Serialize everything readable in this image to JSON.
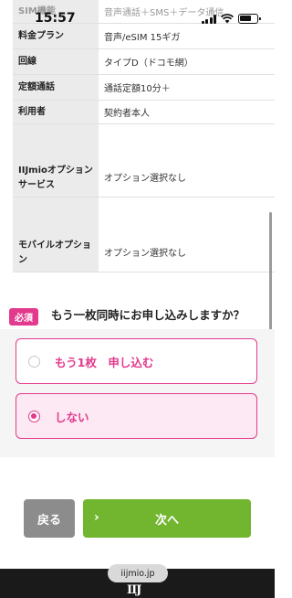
{
  "status_bar": {
    "time": "15:57",
    "icons": [
      "signal-icon",
      "wifi-icon",
      "battery-icon"
    ]
  },
  "table": {
    "rows": [
      {
        "label": "SIM機能",
        "value": "音声通話＋SMS＋データ通信"
      },
      {
        "label": "料金プラン",
        "value": "音声/eSIM 15ギガ"
      },
      {
        "label": "回線",
        "value": "タイプD（ドコモ網）"
      },
      {
        "label": "定額通話",
        "value": "通話定額10分＋"
      },
      {
        "label": "利用者",
        "value": "契約者本人"
      },
      {
        "label": "IIJmioオプションサービス",
        "value": "オプション選択なし"
      },
      {
        "label": "モバイルオプション",
        "value": "オプション選択なし"
      }
    ]
  },
  "question": {
    "badge": "必須",
    "text": "もう一枚同時にお申し込みしますか？"
  },
  "options": [
    {
      "label": "もう1枚　申し込む",
      "selected": false
    },
    {
      "label": "しない",
      "selected": true
    }
  ],
  "buttons": {
    "back": "戻る",
    "next": "次へ"
  },
  "browser": {
    "url": "iijmio.jp"
  },
  "colors": {
    "accent": "#e33a8d",
    "next_button": "#72b52f",
    "back_button": "#8c8c8c"
  }
}
